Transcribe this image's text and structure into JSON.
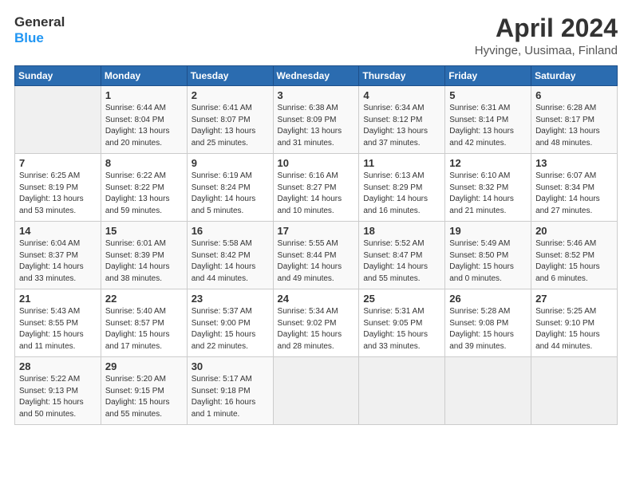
{
  "logo": {
    "line1": "General",
    "line2": "Blue"
  },
  "title": "April 2024",
  "location": "Hyvinge, Uusimaa, Finland",
  "days_of_week": [
    "Sunday",
    "Monday",
    "Tuesday",
    "Wednesday",
    "Thursday",
    "Friday",
    "Saturday"
  ],
  "weeks": [
    [
      {
        "num": "",
        "data": ""
      },
      {
        "num": "1",
        "data": "Sunrise: 6:44 AM\nSunset: 8:04 PM\nDaylight: 13 hours\nand 20 minutes."
      },
      {
        "num": "2",
        "data": "Sunrise: 6:41 AM\nSunset: 8:07 PM\nDaylight: 13 hours\nand 25 minutes."
      },
      {
        "num": "3",
        "data": "Sunrise: 6:38 AM\nSunset: 8:09 PM\nDaylight: 13 hours\nand 31 minutes."
      },
      {
        "num": "4",
        "data": "Sunrise: 6:34 AM\nSunset: 8:12 PM\nDaylight: 13 hours\nand 37 minutes."
      },
      {
        "num": "5",
        "data": "Sunrise: 6:31 AM\nSunset: 8:14 PM\nDaylight: 13 hours\nand 42 minutes."
      },
      {
        "num": "6",
        "data": "Sunrise: 6:28 AM\nSunset: 8:17 PM\nDaylight: 13 hours\nand 48 minutes."
      }
    ],
    [
      {
        "num": "7",
        "data": "Sunrise: 6:25 AM\nSunset: 8:19 PM\nDaylight: 13 hours\nand 53 minutes."
      },
      {
        "num": "8",
        "data": "Sunrise: 6:22 AM\nSunset: 8:22 PM\nDaylight: 13 hours\nand 59 minutes."
      },
      {
        "num": "9",
        "data": "Sunrise: 6:19 AM\nSunset: 8:24 PM\nDaylight: 14 hours\nand 5 minutes."
      },
      {
        "num": "10",
        "data": "Sunrise: 6:16 AM\nSunset: 8:27 PM\nDaylight: 14 hours\nand 10 minutes."
      },
      {
        "num": "11",
        "data": "Sunrise: 6:13 AM\nSunset: 8:29 PM\nDaylight: 14 hours\nand 16 minutes."
      },
      {
        "num": "12",
        "data": "Sunrise: 6:10 AM\nSunset: 8:32 PM\nDaylight: 14 hours\nand 21 minutes."
      },
      {
        "num": "13",
        "data": "Sunrise: 6:07 AM\nSunset: 8:34 PM\nDaylight: 14 hours\nand 27 minutes."
      }
    ],
    [
      {
        "num": "14",
        "data": "Sunrise: 6:04 AM\nSunset: 8:37 PM\nDaylight: 14 hours\nand 33 minutes."
      },
      {
        "num": "15",
        "data": "Sunrise: 6:01 AM\nSunset: 8:39 PM\nDaylight: 14 hours\nand 38 minutes."
      },
      {
        "num": "16",
        "data": "Sunrise: 5:58 AM\nSunset: 8:42 PM\nDaylight: 14 hours\nand 44 minutes."
      },
      {
        "num": "17",
        "data": "Sunrise: 5:55 AM\nSunset: 8:44 PM\nDaylight: 14 hours\nand 49 minutes."
      },
      {
        "num": "18",
        "data": "Sunrise: 5:52 AM\nSunset: 8:47 PM\nDaylight: 14 hours\nand 55 minutes."
      },
      {
        "num": "19",
        "data": "Sunrise: 5:49 AM\nSunset: 8:50 PM\nDaylight: 15 hours\nand 0 minutes."
      },
      {
        "num": "20",
        "data": "Sunrise: 5:46 AM\nSunset: 8:52 PM\nDaylight: 15 hours\nand 6 minutes."
      }
    ],
    [
      {
        "num": "21",
        "data": "Sunrise: 5:43 AM\nSunset: 8:55 PM\nDaylight: 15 hours\nand 11 minutes."
      },
      {
        "num": "22",
        "data": "Sunrise: 5:40 AM\nSunset: 8:57 PM\nDaylight: 15 hours\nand 17 minutes."
      },
      {
        "num": "23",
        "data": "Sunrise: 5:37 AM\nSunset: 9:00 PM\nDaylight: 15 hours\nand 22 minutes."
      },
      {
        "num": "24",
        "data": "Sunrise: 5:34 AM\nSunset: 9:02 PM\nDaylight: 15 hours\nand 28 minutes."
      },
      {
        "num": "25",
        "data": "Sunrise: 5:31 AM\nSunset: 9:05 PM\nDaylight: 15 hours\nand 33 minutes."
      },
      {
        "num": "26",
        "data": "Sunrise: 5:28 AM\nSunset: 9:08 PM\nDaylight: 15 hours\nand 39 minutes."
      },
      {
        "num": "27",
        "data": "Sunrise: 5:25 AM\nSunset: 9:10 PM\nDaylight: 15 hours\nand 44 minutes."
      }
    ],
    [
      {
        "num": "28",
        "data": "Sunrise: 5:22 AM\nSunset: 9:13 PM\nDaylight: 15 hours\nand 50 minutes."
      },
      {
        "num": "29",
        "data": "Sunrise: 5:20 AM\nSunset: 9:15 PM\nDaylight: 15 hours\nand 55 minutes."
      },
      {
        "num": "30",
        "data": "Sunrise: 5:17 AM\nSunset: 9:18 PM\nDaylight: 16 hours\nand 1 minute."
      },
      {
        "num": "",
        "data": ""
      },
      {
        "num": "",
        "data": ""
      },
      {
        "num": "",
        "data": ""
      },
      {
        "num": "",
        "data": ""
      }
    ]
  ]
}
